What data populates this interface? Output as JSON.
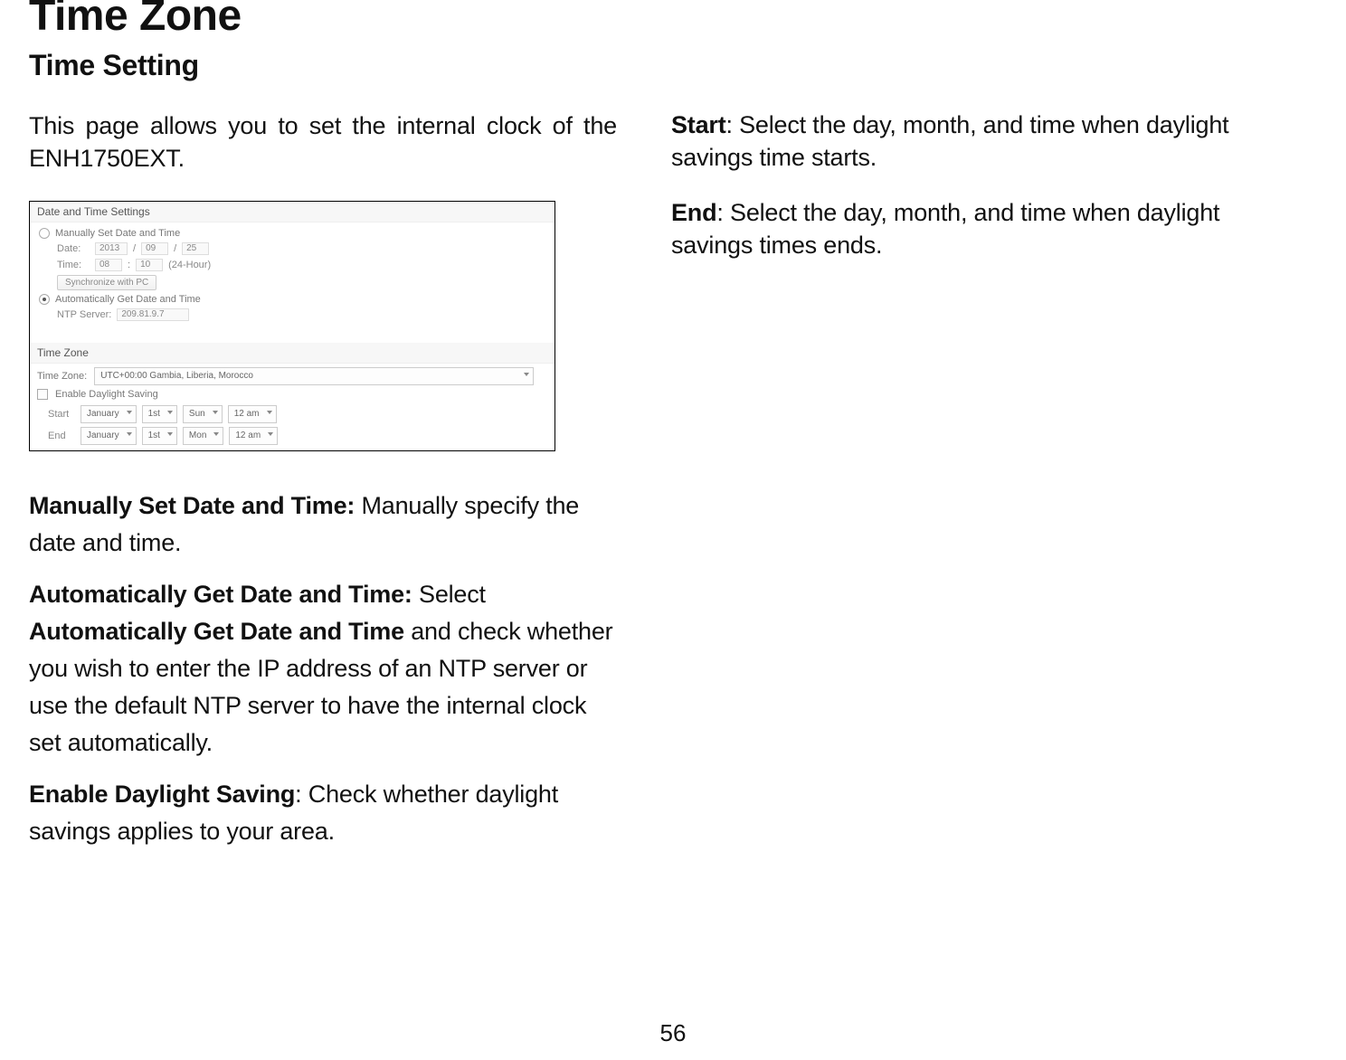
{
  "title": "Time Zone",
  "subtitle": "Time Setting",
  "intro": "This page allows you to set the internal clock of the ENH1750EXT.",
  "settings": {
    "section1_title": "Date and Time Settings",
    "radio_manual": "Manually Set Date and Time",
    "date_label": "Date:",
    "date_year": "2013",
    "date_month": "09",
    "date_day": "25",
    "time_label": "Time:",
    "time_hour": "08",
    "time_min": "10",
    "time_suffix": "(24-Hour)",
    "sync_btn": "Synchronize with PC",
    "radio_auto": "Automatically Get Date and Time",
    "ntp_label": "NTP Server:",
    "ntp_value": "209.81.9.7",
    "section2_title": "Time Zone",
    "tz_label": "Time Zone:",
    "tz_value": "UTC+00:00 Gambia, Liberia, Morocco",
    "dst_check": "Enable Daylight Saving",
    "start_label": "Start",
    "end_label": "End",
    "sel_month1": "January",
    "sel_month2": "January",
    "sel_ord1": "1st",
    "sel_ord2": "1st",
    "sel_day1": "Sun",
    "sel_day2": "Mon",
    "sel_time1": "12 am",
    "sel_time2": "12 am"
  },
  "left_paras": {
    "p1_bold": "Manually Set Date and Time:",
    "p1_rest": " Manually specify the date and time.",
    "p2_bold1": "Automatically Get Date and Time:",
    "p2_rest1": " Select ",
    "p2_bold2": "Automatically Get Date and Time",
    "p2_rest2": " and check whether you wish to enter the IP address of an NTP server or use the default NTP server to have the internal clock set automatically.",
    "p3_bold": "Enable Daylight Saving",
    "p3_rest": ": Check whether daylight savings applies to your area."
  },
  "right_paras": {
    "p1_bold": "Start",
    "p1_rest": ": Select the day, month, and time when daylight savings time starts.",
    "p2_bold": "End",
    "p2_rest": ": Select the day, month, and time when daylight savings times ends."
  },
  "page_number": "56"
}
